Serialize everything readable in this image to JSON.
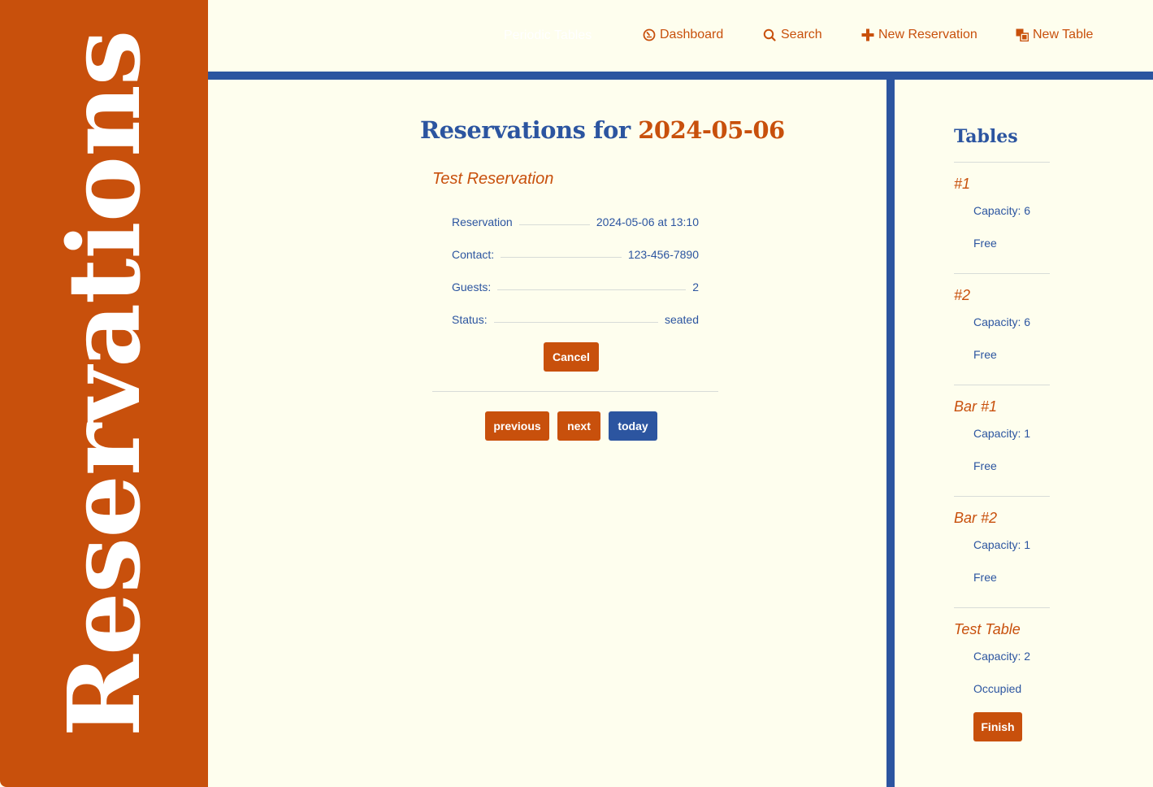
{
  "brand": {
    "title": "Reservations"
  },
  "nav": {
    "ghost_text": "Periodic Tables",
    "items": [
      {
        "label": "Dashboard",
        "icon": "dashboard-icon"
      },
      {
        "label": "Search",
        "icon": "search-icon"
      },
      {
        "label": "New Reservation",
        "icon": "plus-icon"
      },
      {
        "label": "New Table",
        "icon": "table-icon"
      }
    ]
  },
  "main": {
    "heading_prefix": "Reservations for",
    "date": "2024-05-06",
    "reservation": {
      "name": "Test Reservation",
      "details": [
        {
          "label": "Reservation",
          "value": "2024-05-06 at 13:10"
        },
        {
          "label": "Contact:",
          "value": "123-456-7890"
        },
        {
          "label": "Guests:",
          "value": "2"
        },
        {
          "label": "Status:",
          "value": "seated"
        }
      ],
      "cancel_label": "Cancel"
    },
    "pager": {
      "previous": "previous",
      "next": "next",
      "today": "today"
    }
  },
  "tables": {
    "title": "Tables",
    "items": [
      {
        "name": "#1",
        "capacity": "Capacity: 6",
        "status": "Free"
      },
      {
        "name": "#2",
        "capacity": "Capacity: 6",
        "status": "Free"
      },
      {
        "name": "Bar #1",
        "capacity": "Capacity: 1",
        "status": "Free"
      },
      {
        "name": "Bar #2",
        "capacity": "Capacity: 1",
        "status": "Free"
      },
      {
        "name": "Test Table",
        "capacity": "Capacity: 2",
        "status": "Occupied",
        "finish_label": "Finish"
      }
    ]
  },
  "colors": {
    "accent": "#c8500c",
    "primary": "#2c55a0",
    "background": "#fefeee"
  }
}
